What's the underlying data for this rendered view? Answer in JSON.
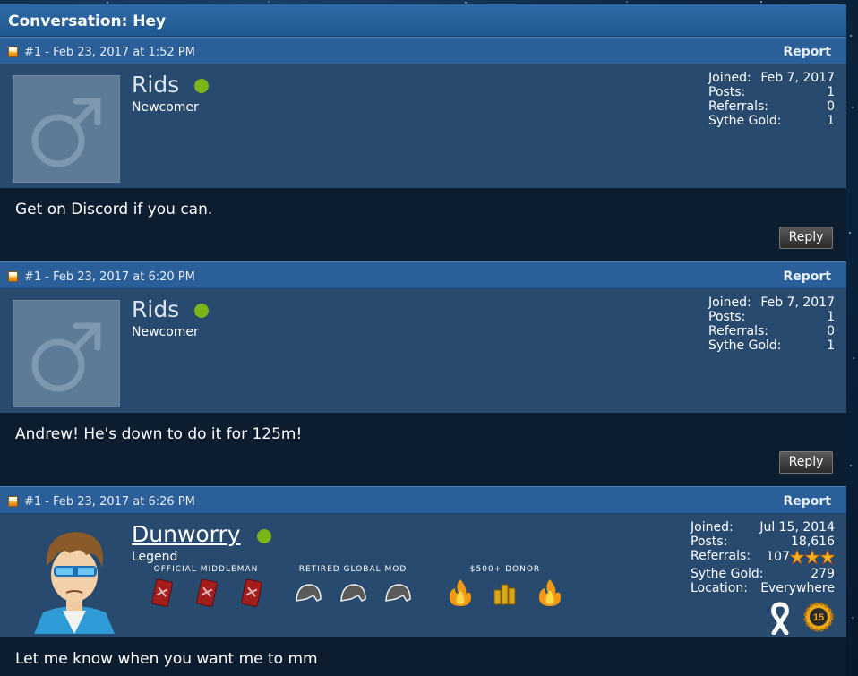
{
  "conversation": {
    "title": "Conversation: Hey"
  },
  "posts": [
    {
      "meta": "#1 - Feb 23, 2017 at 1:52 PM",
      "report_label": "Report",
      "username": "Rids",
      "usertitle": "Newcomer",
      "stats": {
        "joined_label": "Joined:",
        "joined": "Feb 7, 2017",
        "posts_label": "Posts:",
        "posts": "1",
        "referrals_label": "Referrals:",
        "referrals": "0",
        "gold_label": "Sythe Gold:",
        "gold": "1"
      },
      "message": "Get on Discord if you can.",
      "reply_label": "Reply"
    },
    {
      "meta": "#1 - Feb 23, 2017 at 6:20 PM",
      "report_label": "Report",
      "username": "Rids",
      "usertitle": "Newcomer",
      "stats": {
        "joined_label": "Joined:",
        "joined": "Feb 7, 2017",
        "posts_label": "Posts:",
        "posts": "1",
        "referrals_label": "Referrals:",
        "referrals": "0",
        "gold_label": "Sythe Gold:",
        "gold": "1"
      },
      "message": "Andrew! He's down to do it for 125m!",
      "reply_label": "Reply"
    },
    {
      "meta": "#1 - Feb 23, 2017 at 6:26 PM",
      "report_label": "Report",
      "username": "Dunworry",
      "usertitle": "Legend",
      "awards": [
        {
          "title": "OFFICIAL MIDDLEMAN",
          "icon": "middleman-card-icon"
        },
        {
          "title": "RETIRED GLOBAL MOD",
          "icon": "helmet-icon"
        },
        {
          "title": "$500+ DONOR",
          "icon": "flame-gold-icon"
        }
      ],
      "stats": {
        "joined_label": "Joined:",
        "joined": "Jul 15, 2014",
        "posts_label": "Posts:",
        "posts": "18,616",
        "referrals_label": "Referrals:",
        "referrals": "107",
        "gold_label": "Sythe Gold:",
        "gold": "279",
        "location_label": "Location:",
        "location": "Everywhere"
      },
      "message": "Let me know when you want me to mm"
    }
  ]
}
